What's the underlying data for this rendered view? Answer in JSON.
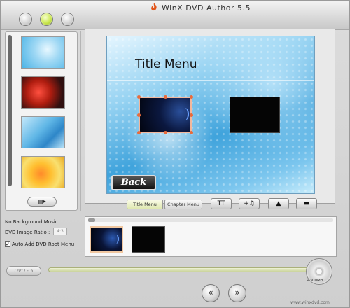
{
  "window": {
    "title": "WinX DVD Author 5.5"
  },
  "left_panel": {
    "tool_button_label": "▤▸"
  },
  "preview": {
    "title": "Title Menu",
    "back_label": "Back"
  },
  "tabs": [
    {
      "label": "Title Menu"
    },
    {
      "label": "Chapter Menu"
    }
  ],
  "tools": [
    {
      "label": "TT"
    },
    {
      "label": "+♫"
    },
    {
      "label": "▲"
    },
    {
      "label": "▬"
    }
  ],
  "options": {
    "music_text": "No Background Music",
    "ratio_label": "DVD Image Ratio :",
    "ratio_value": "4:3",
    "auto_add_label": "Auto Add DVD Root Menu",
    "auto_add_checked": "✓"
  },
  "bottom": {
    "dvd_label": "DVD - 5",
    "disc_size": "4300MB",
    "prev_label": "«",
    "next_label": "»",
    "website": "www.winxdvd.com"
  },
  "colors": {
    "accent_green": "#c8e64a",
    "selection_orange": "#e86b3c"
  }
}
